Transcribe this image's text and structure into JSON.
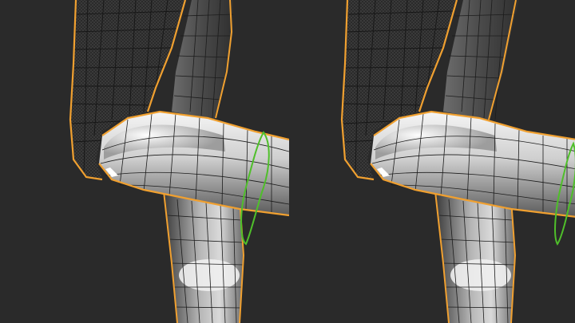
{
  "app": {
    "title": "",
    "background_color": "#2a2a2a"
  },
  "viewports": [
    {
      "label": "",
      "panel": "left",
      "object_state": "selected"
    },
    {
      "label": "",
      "panel": "right",
      "object_state": "selected"
    }
  ],
  "colors": {
    "selection_outline": "#f0a030",
    "active_loop": "#4fbf2a",
    "mesh_wire": "#1c1c1c",
    "shaded_light": "#f2f2f2",
    "shaded_mid": "#8d8d8d",
    "shaded_dark": "#3b3b3b"
  },
  "icons": {
    "thigh_mesh": "mesh-object-icon",
    "shin_mesh": "mesh-object-icon"
  }
}
